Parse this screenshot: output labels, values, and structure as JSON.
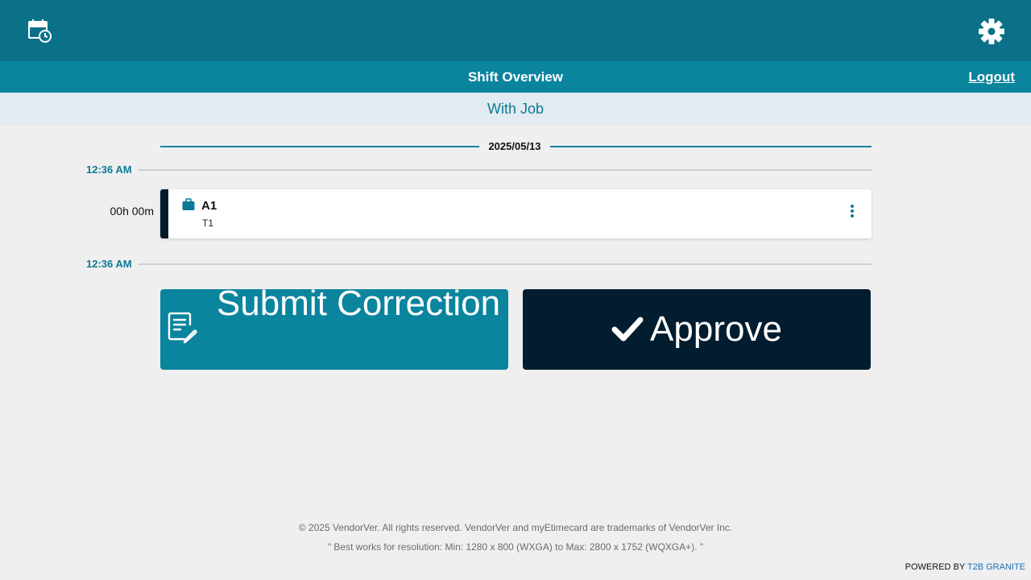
{
  "header": {
    "calendar_icon": "calendar-clock-icon",
    "settings_icon": "gear-icon"
  },
  "titlebar": {
    "title": "Shift Overview",
    "logout_label": "Logout"
  },
  "subheader": {
    "title": "With Job"
  },
  "timeline": {
    "date": "2025/05/13",
    "start_time": "12:36 AM",
    "end_time": "12:36 AM",
    "duration": "00h 00m"
  },
  "shift": {
    "job": "A1",
    "task": "T1",
    "job_icon": "briefcase-icon",
    "menu_icon": "more-vertical-icon"
  },
  "actions": {
    "submit_label": "Submit Correction",
    "submit_icon": "edit-document-icon",
    "approve_label": "Approve",
    "approve_icon": "checkmark-icon"
  },
  "footer": {
    "copyright": "© 2025 VendorVer. All rights reserved. VendorVer and myEtimecard are trademarks of VendorVer Inc.",
    "resolution_note": "\" Best works for resolution: Min: 1280 x 800 (WXGA) to Max: 2800 x 1752 (WQXGA+). \"",
    "powered_prefix": "POWERED BY",
    "powered_brand": "T2B GRANITE"
  },
  "colors": {
    "topbar": "#0a7189",
    "titlebar": "#0b849e",
    "subbar": "#e2ebf1",
    "accent": "#0b7a94",
    "approve": "#021d2f",
    "background": "#efefef"
  }
}
